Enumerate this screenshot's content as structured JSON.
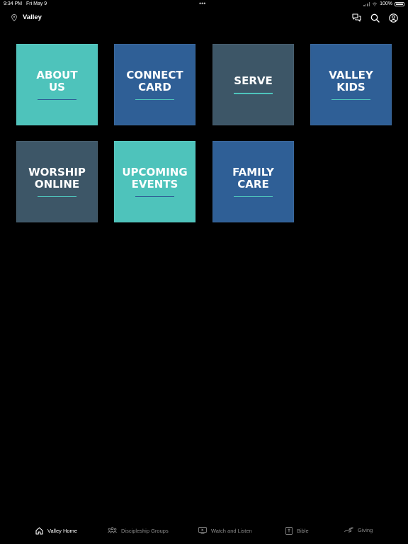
{
  "status": {
    "time": "9:34 PM",
    "date": "Fri May 9",
    "dots": "•••",
    "battery": "100%"
  },
  "header": {
    "title": "Valley"
  },
  "colors": {
    "teal": "#4EC3BB",
    "blue": "#2F5F96",
    "slate": "#3D5667",
    "active": "#ffffff",
    "inactive": "#8a8a8a"
  },
  "tiles": [
    {
      "label": "ABOUT\nUS",
      "color": "#4EC3BB",
      "line": "#2F5F96"
    },
    {
      "label": "CONNECT\nCARD",
      "color": "#2F5F96",
      "line": "#4EC3BB"
    },
    {
      "label": "SERVE",
      "color": "#3D5667",
      "line": "#4EC3BB"
    },
    {
      "label": "VALLEY\nKIDS",
      "color": "#2F5F96",
      "line": "#4EC3BB"
    },
    {
      "label": "WORSHIP\nONLINE",
      "color": "#3D5667",
      "line": "#4EC3BB"
    },
    {
      "label": "UPCOMING\nEVENTS",
      "color": "#4EC3BB",
      "line": "#2F5F96"
    },
    {
      "label": "FAMILY\nCARE",
      "color": "#2F5F96",
      "line": "#4EC3BB"
    }
  ],
  "tabs": [
    {
      "label": "Valley Home",
      "icon": "home-icon",
      "active": true
    },
    {
      "label": "Discipleship Groups",
      "icon": "group-icon",
      "active": false
    },
    {
      "label": "Watch and Listen",
      "icon": "tv-icon",
      "active": false
    },
    {
      "label": "Bible",
      "icon": "bible-icon",
      "active": false
    },
    {
      "label": "Giving",
      "icon": "giving-icon",
      "active": false
    }
  ]
}
